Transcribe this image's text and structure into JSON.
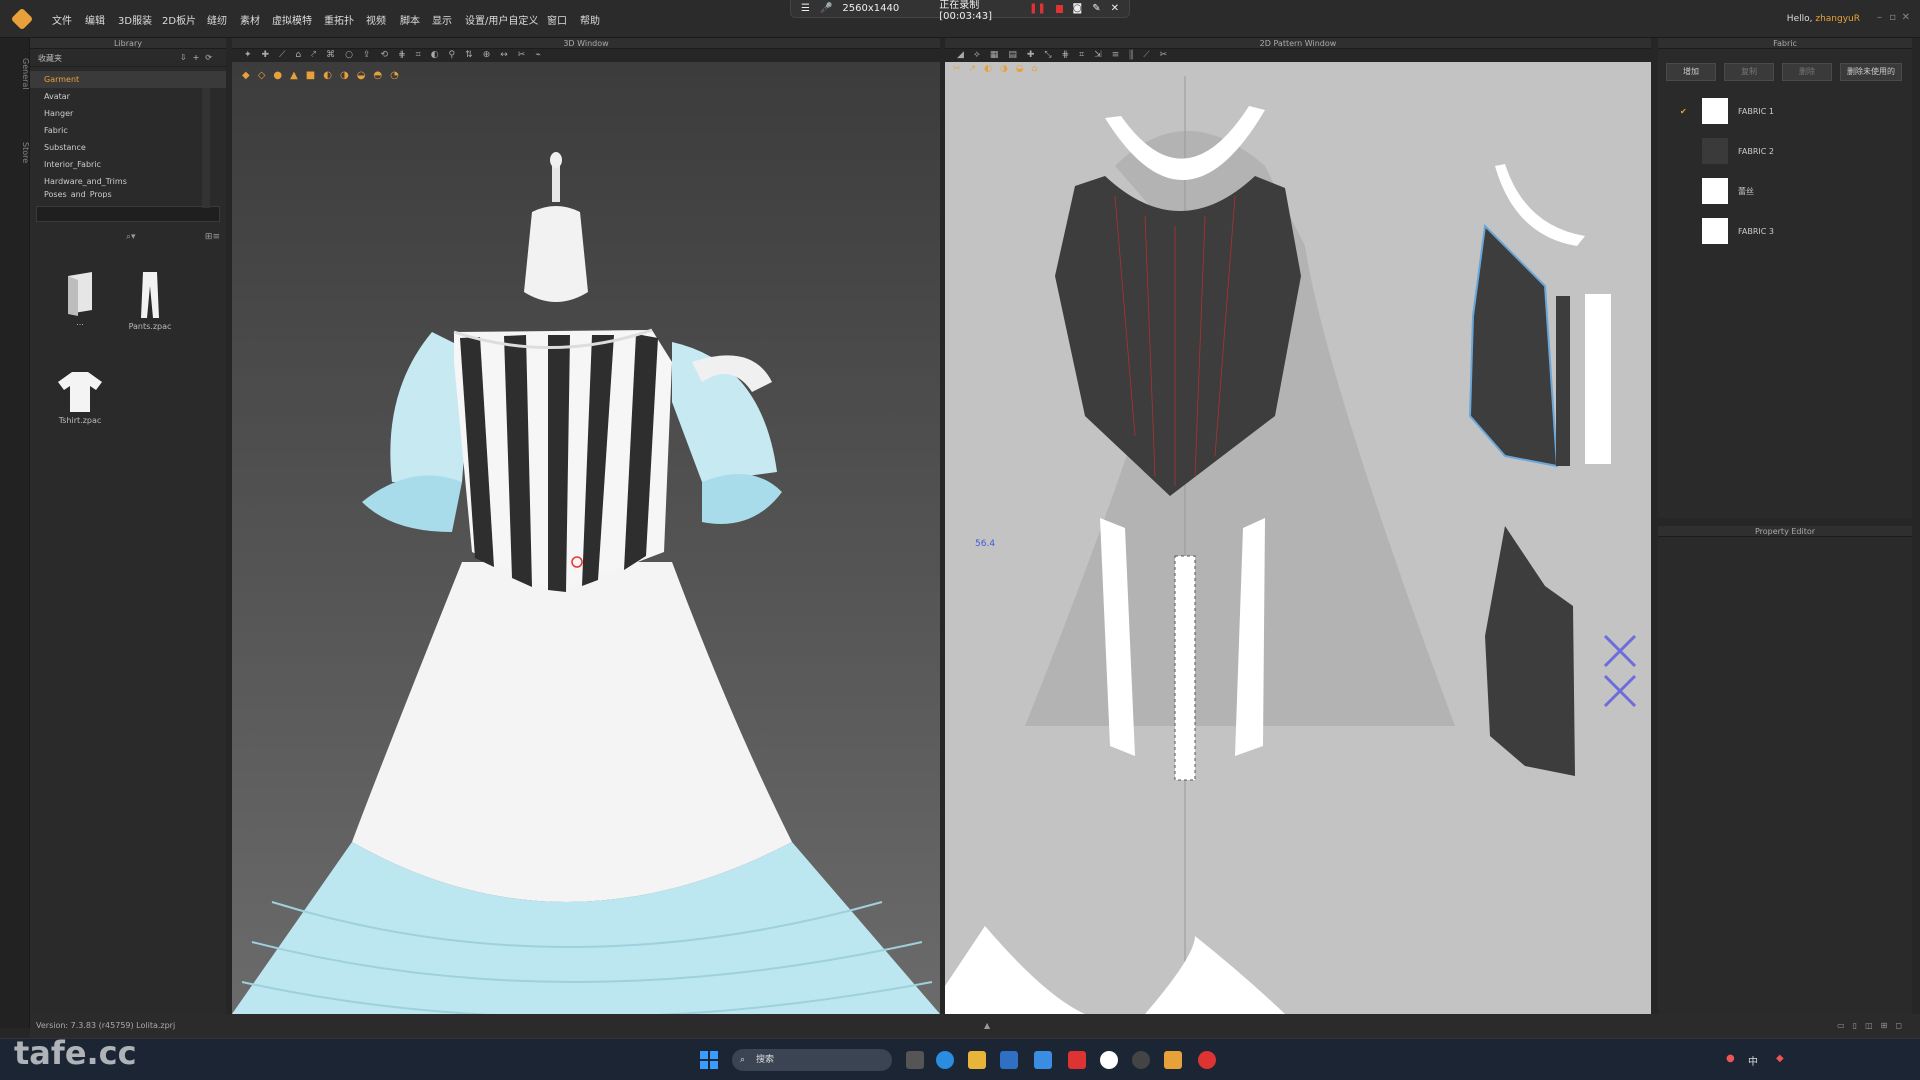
{
  "menubar": {
    "items": [
      "文件",
      "编辑",
      "3D服装",
      "2D板片",
      "缝纫",
      "素材",
      "虚拟模特",
      "重拓扑",
      "视频",
      "脚本",
      "显示",
      "设置/用户自定义",
      "窗口",
      "帮助"
    ],
    "hello": "Hello, ",
    "user": "zhangyuR"
  },
  "recorder": {
    "resolution": "2560x1440",
    "status": "正在录制 [00:03:43]"
  },
  "left_tabs": [
    "General",
    "Store"
  ],
  "library": {
    "title": "Library",
    "toolbar_label": "收藏夹",
    "tree": [
      "Garment",
      "Avatar",
      "Hanger",
      "Fabric",
      "Substance",
      "Interior_Fabric",
      "Hardware_and_Trims",
      "Poses_and_Props"
    ],
    "thumbs": [
      {
        "name": "..."
      },
      {
        "name": "Pants.zpac"
      },
      {
        "name": "Tshirt.zpac"
      }
    ]
  },
  "window3d": {
    "title": "3D Window"
  },
  "window2d": {
    "title": "2D Pattern Window",
    "measure": "56.4"
  },
  "fabric": {
    "title": "Fabric",
    "buttons": [
      "增加",
      "复制",
      "删除",
      "删除未使用的"
    ],
    "items": [
      {
        "name": "FABRIC 1",
        "color": "#ffffff",
        "checked": true
      },
      {
        "name": "FABRIC 2",
        "color": "#3a3a3a",
        "checked": false
      },
      {
        "name": "蕾丝",
        "color": "#ffffff",
        "checked": false
      },
      {
        "name": "FABRIC 3",
        "color": "#ffffff",
        "checked": false
      }
    ]
  },
  "property_editor": {
    "title": "Property Editor"
  },
  "status": {
    "version": "Version:  7.3.83 (r45759)   Lolita.zprj"
  },
  "taskbar": {
    "search": "搜索"
  },
  "watermark": "tafe.cc",
  "colors": {
    "accent": "#e8a13a",
    "sky": "#b9e3ee",
    "dark_fabric": "#3a3a3a"
  }
}
